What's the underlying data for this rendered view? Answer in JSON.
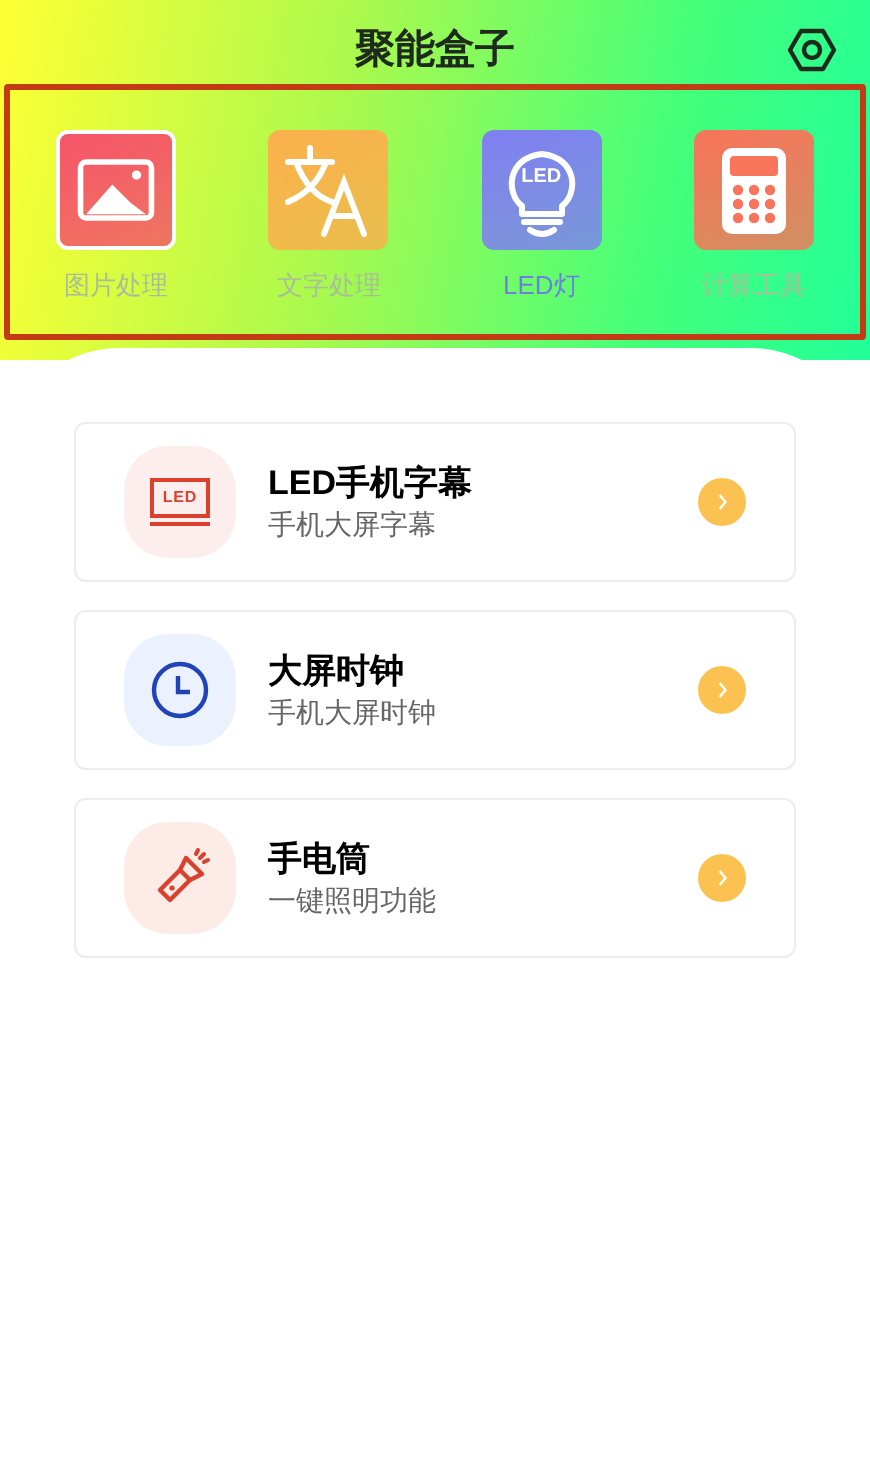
{
  "header": {
    "title": "聚能盒子"
  },
  "tools": [
    {
      "kind": "image",
      "label": "图片处理",
      "color": "#f55469",
      "selected": false
    },
    {
      "kind": "translate",
      "label": "文字处理",
      "color": "#fbb04c",
      "selected": false
    },
    {
      "kind": "bulb",
      "label": "LED灯",
      "icon_text": "LED",
      "color": "#7f7ff2",
      "selected": true
    },
    {
      "kind": "calculator",
      "label": "计算工具",
      "color": "#f8745a",
      "selected": false
    }
  ],
  "features": [
    {
      "kind": "led",
      "title": "LED手机字幕",
      "subtitle": "手机大屏字幕",
      "icon_text": "LED"
    },
    {
      "kind": "clock",
      "title": "大屏时钟",
      "subtitle": "手机大屏时钟"
    },
    {
      "kind": "flashlight",
      "title": "手电筒",
      "subtitle": "一键照明功能"
    }
  ]
}
